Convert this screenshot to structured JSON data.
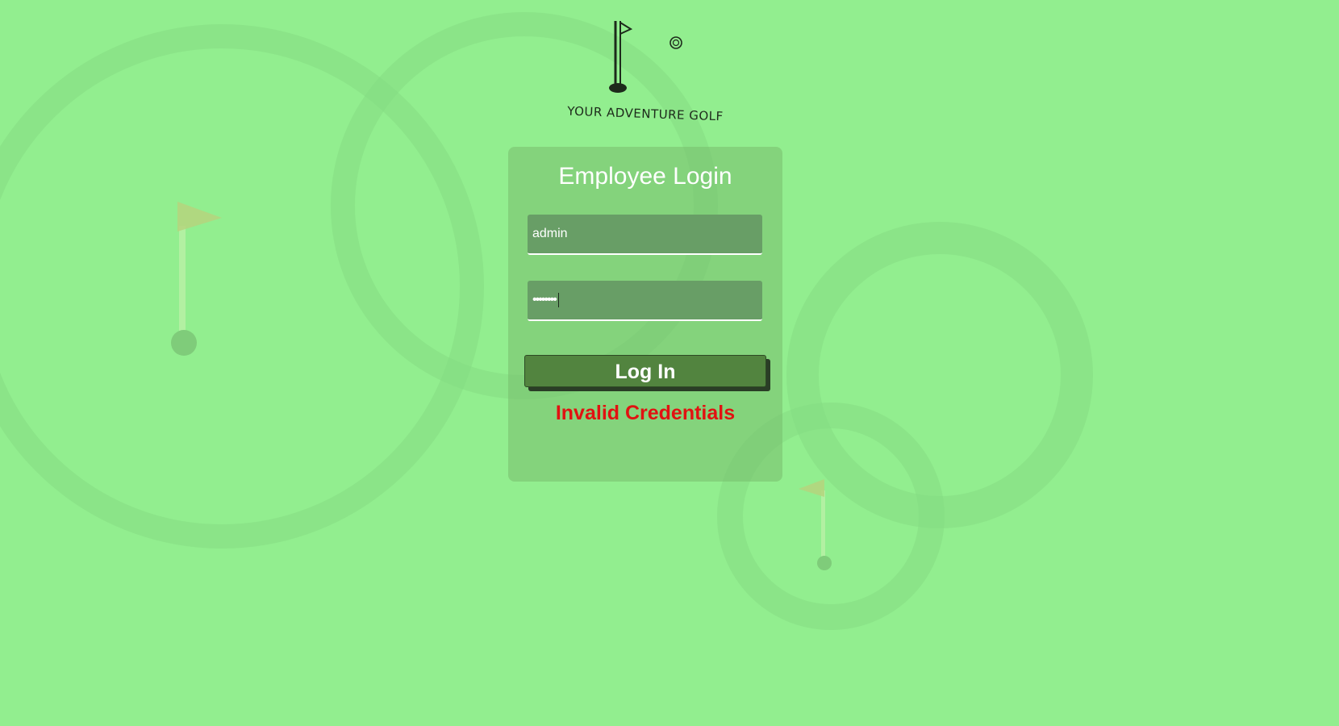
{
  "brand": {
    "name": "YOUR ADVENTURE GOLF"
  },
  "login": {
    "title": "Employee Login",
    "username_value": "admin",
    "password_mask": "••••••••",
    "button_label": "Log In",
    "error_message": "Invalid Credentials"
  },
  "colors": {
    "background": "#92ee8f",
    "field": "#689e66",
    "button": "#52843f",
    "error": "#e21111"
  },
  "icons": [
    "golf-flag-logo-icon",
    "golf-ball-icon",
    "flag-decoration-icon"
  ]
}
